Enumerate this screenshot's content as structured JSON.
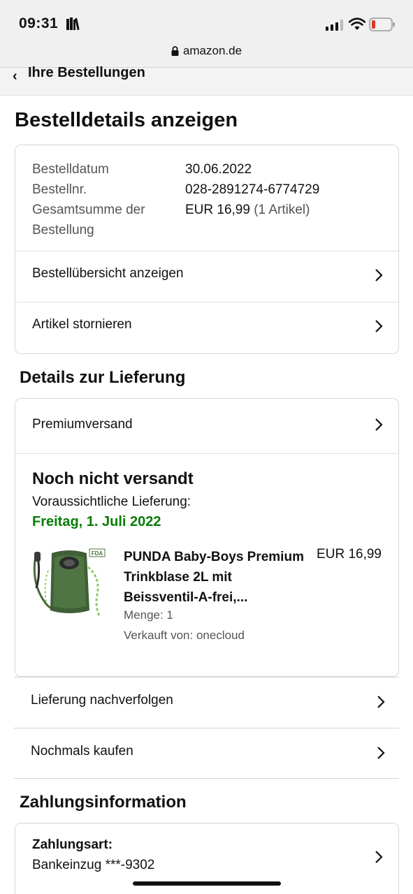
{
  "status_bar": {
    "time": "09:31"
  },
  "browser": {
    "url": "amazon.de"
  },
  "back_nav": {
    "label": "Ihre Bestellungen"
  },
  "page_title": "Bestelldetails anzeigen",
  "order_summary": {
    "rows": [
      {
        "key": "Bestelldatum",
        "value": "30.06.2022",
        "extra": ""
      },
      {
        "key": "Bestellnr.",
        "value": "028-2891274-6774729",
        "extra": ""
      },
      {
        "key": "Gesamtsumme der Bestellung",
        "value": "EUR 16,99",
        "extra": "(1 Artikel)"
      }
    ],
    "actions": [
      "Bestellübersicht anzeigen",
      "Artikel stornieren"
    ]
  },
  "delivery": {
    "section_title": "Details zur Lieferung",
    "shipping_method": "Premiumversand",
    "status": "Noch nicht versandt",
    "eta_label": "Voraussichtliche Lieferung:",
    "eta_date": "Freitag, 1. Juli 2022",
    "item": {
      "title": "PUNDA Baby-Boys Premium Trinkblase 2L mit Beissventil-A-frei,...",
      "price": "EUR 16,99",
      "quantity": "Menge: 1",
      "seller": "Verkauft von: onecloud",
      "image_badge": "FDA"
    },
    "actions": [
      "Lieferung nachverfolgen",
      "Nochmals kaufen"
    ]
  },
  "payment": {
    "section_title": "Zahlungsinformation",
    "method_label": "Zahlungsart:",
    "method_value": "Bankeinzug ***-9302"
  },
  "colors": {
    "delivery_green": "#067d06",
    "border": "#d5d9d9",
    "battery_low": "#e0392b"
  }
}
